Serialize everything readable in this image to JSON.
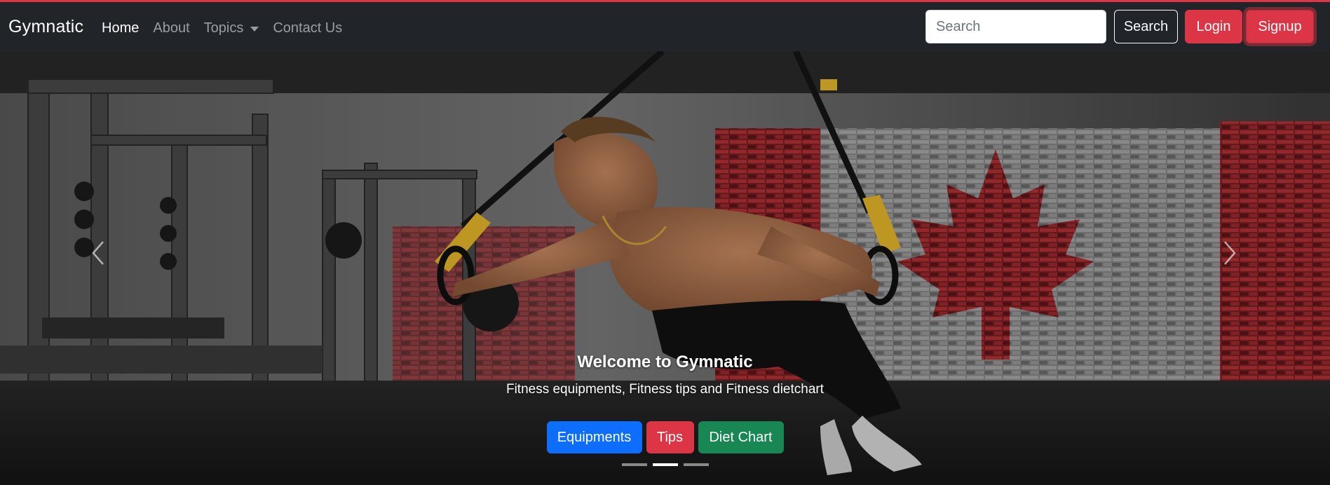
{
  "navbar": {
    "brand": "Gymnatic",
    "links": [
      {
        "label": "Home",
        "active": true
      },
      {
        "label": "About",
        "active": false
      },
      {
        "label": "Topics",
        "active": false,
        "dropdown": true
      },
      {
        "label": "Contact Us",
        "active": false
      }
    ],
    "search": {
      "placeholder": "Search",
      "value": ""
    },
    "search_button": "Search",
    "login_button": "Login",
    "signup_button": "Signup"
  },
  "carousel": {
    "title": "Welcome to Gymnatic",
    "subtitle": "Fitness equipments, Fitness tips and Fitness dietchart",
    "buttons": [
      "Equipments",
      "Tips",
      "Diet Chart"
    ],
    "slide_count": 3,
    "active_slide": 2
  },
  "colors": {
    "navbar_bg": "#212529",
    "accent": "#dc3545",
    "primary": "#0d6efd",
    "success": "#198754"
  }
}
